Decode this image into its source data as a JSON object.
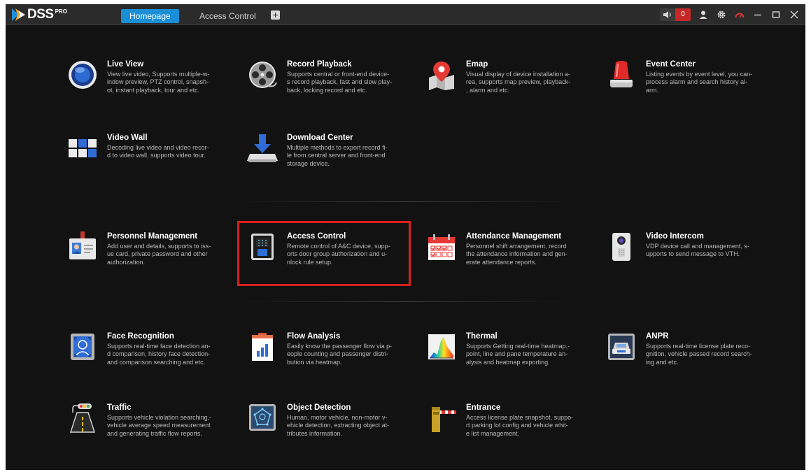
{
  "topbar": {
    "logo_text": "DSS",
    "logo_sup": "PRO",
    "tabs": [
      {
        "label": "Homepage",
        "active": true
      },
      {
        "label": "Access Control",
        "active": false
      }
    ],
    "add_tab_icon": "plus-icon",
    "alarm_count": "0",
    "icons": [
      "speaker-icon",
      "user-icon",
      "gear-icon",
      "gauge-icon",
      "minimize-icon",
      "maximize-icon",
      "close-icon"
    ]
  },
  "modules": {
    "live_view": {
      "title": "Live View",
      "desc": "View live video, Supports multiple-w-\nindow preview, PTZ control, snapsh-\not, instant playback, tour and etc."
    },
    "record_playback": {
      "title": "Record Playback",
      "desc": "Supports central or front-end device-\ns record playback, fast and slow play-\nback, locking record and etc."
    },
    "emap": {
      "title": "Emap",
      "desc": "Visual display of device installation a-\nrea, supports map preview, playback-\n, alarm and etc."
    },
    "event_center": {
      "title": "Event Center",
      "desc": "Listing events by event level, you can-\n process alarm and search history al-\narm."
    },
    "video_wall": {
      "title": "Video Wall",
      "desc": "Decoding live video and video recor-\nd to video wall, supports video tour."
    },
    "download_center": {
      "title": "Download Center",
      "desc": "Multiple methods to export record fi-\nle from central server and front-end\nstorage device."
    },
    "personnel_management": {
      "title": "Personnel Management",
      "desc": "Add user and details, supports to iss-\nue card, private password and other\nauthorization."
    },
    "access_control": {
      "title": "Access Control",
      "desc": "Remote control of A&C device, supp-\norts door group authorization and u-\nnlock rule setup."
    },
    "attendance_management": {
      "title": "Attendance Management",
      "desc": "Personnel shift arrangement, record\nthe attendance information and gen-\nerate attendance reports."
    },
    "video_intercom": {
      "title": "Video Intercom",
      "desc": "VDP device call and management, s-\nupports to send message to VTH."
    },
    "face_recognition": {
      "title": "Face Recognition",
      "desc": "Supports real-time face detection an-\nd comparison, history face detection-\n and comparison searching and etc."
    },
    "flow_analysis": {
      "title": "Flow Analysis",
      "desc": "Easily know the passenger flow via p-\neople counting and passenger distri-\nbution via heatmap."
    },
    "thermal": {
      "title": "Thermal",
      "desc": "Supports Getting real-time heatmap,-\n point, line and pane temperature an-\nalysis and heatmap exporting."
    },
    "anpr": {
      "title": "ANPR",
      "desc": "Supports real-time license plate reco-\ngnition, vehicle passed record search-\ning and etc."
    },
    "traffic": {
      "title": "Traffic",
      "desc": "Supports vehicle violation searching,-\n vehicle average speed measurement\nand generating traffic flow reports."
    },
    "object_detection": {
      "title": "Object Detection",
      "desc": "Human, motor vehicle, non-motor v-\nehicle detection, extracting object at-\ntributes information."
    },
    "entrance": {
      "title": "Entrance",
      "desc": "Access license plate snapshot, suppo-\nrt parking lot config and vehicle whit-\ne list management."
    }
  },
  "colors": {
    "accent": "#1a8fd7",
    "highlight": "#d81e1e",
    "background": "#121212",
    "alarm": "#c62828"
  }
}
